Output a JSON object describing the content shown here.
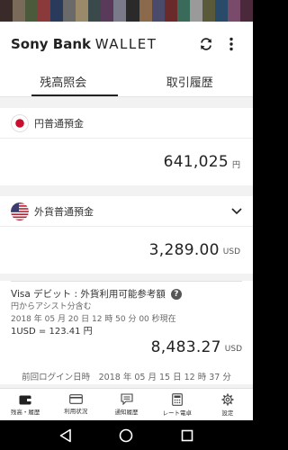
{
  "status_colors": [
    "#3a2a2a",
    "#7a6a5a",
    "#4a5a3a",
    "#8a3a3a",
    "#2a3a5a",
    "#6a6a6a",
    "#9a8a6a",
    "#3a4a4a",
    "#5a3a5a",
    "#7a7a8a",
    "#2a2a2a",
    "#8a6a4a",
    "#4a4a6a",
    "#6a2a2a",
    "#3a6a5a",
    "#9a9a9a",
    "#5a5a3a",
    "#2a4a6a",
    "#7a4a6a",
    "#4a2a3a"
  ],
  "app": {
    "brand_bold": "Sony Bank",
    "brand_light": "WALLET"
  },
  "tabs": [
    {
      "label": "残高照会",
      "active": true
    },
    {
      "label": "取引履歴",
      "active": false
    }
  ],
  "jpy_account": {
    "title": "円普通預金",
    "amount": "641,025",
    "unit": "円"
  },
  "usd_account": {
    "title": "外貨普通預金",
    "amount": "3,289.00",
    "unit": "USD"
  },
  "visa": {
    "title": "Visa デビット : 外貨利用可能参考額",
    "help": "?",
    "assist": "円からアシスト分含む",
    "timestamp": "2018 年 05 月 20 日 12 時 50 分 00 秒現在",
    "rate": "1USD = 123.41 円",
    "amount": "8,483.27",
    "unit": "USD"
  },
  "last_login": "前回ログイン日時　2018 年 05 月 15 日 12 時 37 分",
  "bottom_nav": [
    {
      "label": "残高・履歴",
      "icon": "wallet-icon"
    },
    {
      "label": "利用状況",
      "icon": "card-icon"
    },
    {
      "label": "通知履歴",
      "icon": "message-icon"
    },
    {
      "label": "レート電卓",
      "icon": "calculator-icon"
    },
    {
      "label": "設定",
      "icon": "gear-icon"
    }
  ]
}
